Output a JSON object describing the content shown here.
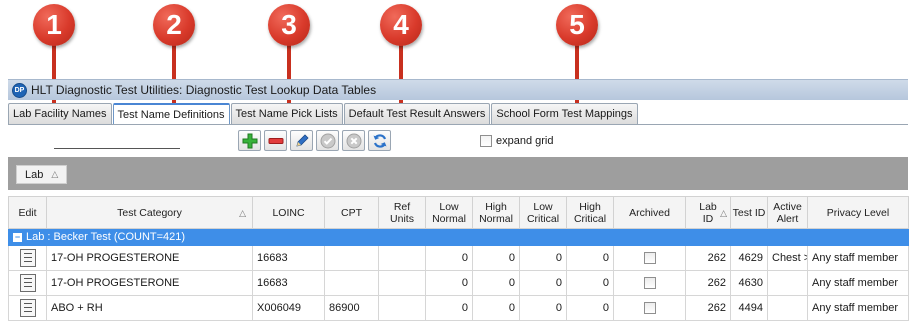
{
  "markers": [
    "1",
    "2",
    "3",
    "4",
    "5"
  ],
  "app": {
    "icon_text": "DP",
    "title": "HLT Diagnostic Test Utilities:  Diagnostic Test Lookup Data Tables"
  },
  "tabs": [
    {
      "label": "Lab Facility Names"
    },
    {
      "label": "Test Name Definitions",
      "active": true
    },
    {
      "label": "Test Name Pick Lists"
    },
    {
      "label": "Default Test Result Answers"
    },
    {
      "label": "School Form Test Mappings"
    }
  ],
  "toolbar": {
    "buttons": [
      "add-icon",
      "remove-icon",
      "edit-pencil-icon",
      "approve-icon",
      "cancel-icon",
      "refresh-icon"
    ],
    "expand_label": "expand grid"
  },
  "group_panel": {
    "chip_label": "Lab",
    "chip_sort": "△"
  },
  "grid": {
    "columns": {
      "edit": "Edit",
      "category": "Test Category",
      "loinc": "LOINC",
      "cpt": "CPT",
      "ref_units_1": "Ref",
      "ref_units_2": "Units",
      "low_normal_1": "Low",
      "low_normal_2": "Normal",
      "high_normal_1": "High",
      "high_normal_2": "Normal",
      "low_critical_1": "Low",
      "low_critical_2": "Critical",
      "high_critical_1": "High",
      "high_critical_2": "Critical",
      "archived": "Archived",
      "lab_id_1": "Lab",
      "lab_id_2": "ID",
      "test_id": "Test ID",
      "active_alert_1": "Active",
      "active_alert_2": "Alert",
      "privacy": "Privacy Level",
      "sort_glyph": "△"
    },
    "group_row": {
      "minus": "−",
      "label": "Lab : Becker Test (COUNT=421)"
    },
    "rows": [
      {
        "category": "17-OH PROGESTERONE",
        "loinc": "16683",
        "cpt": "",
        "ref_units": "",
        "low_normal": "0",
        "high_normal": "0",
        "low_critical": "0",
        "high_critical": "0",
        "lab_id": "262",
        "test_id": "4629",
        "active_alert": "Chest >",
        "privacy": "Any staff member"
      },
      {
        "category": "17-OH PROGESTERONE",
        "loinc": "16683",
        "cpt": "",
        "ref_units": "",
        "low_normal": "0",
        "high_normal": "0",
        "low_critical": "0",
        "high_critical": "0",
        "lab_id": "262",
        "test_id": "4630",
        "active_alert": "",
        "privacy": "Any staff member"
      },
      {
        "category": "ABO + RH",
        "loinc": "X006049",
        "cpt": "86900",
        "ref_units": "",
        "low_normal": "0",
        "high_normal": "0",
        "low_critical": "0",
        "high_critical": "0",
        "lab_id": "262",
        "test_id": "4494",
        "active_alert": "",
        "privacy": "Any staff member"
      }
    ]
  }
}
